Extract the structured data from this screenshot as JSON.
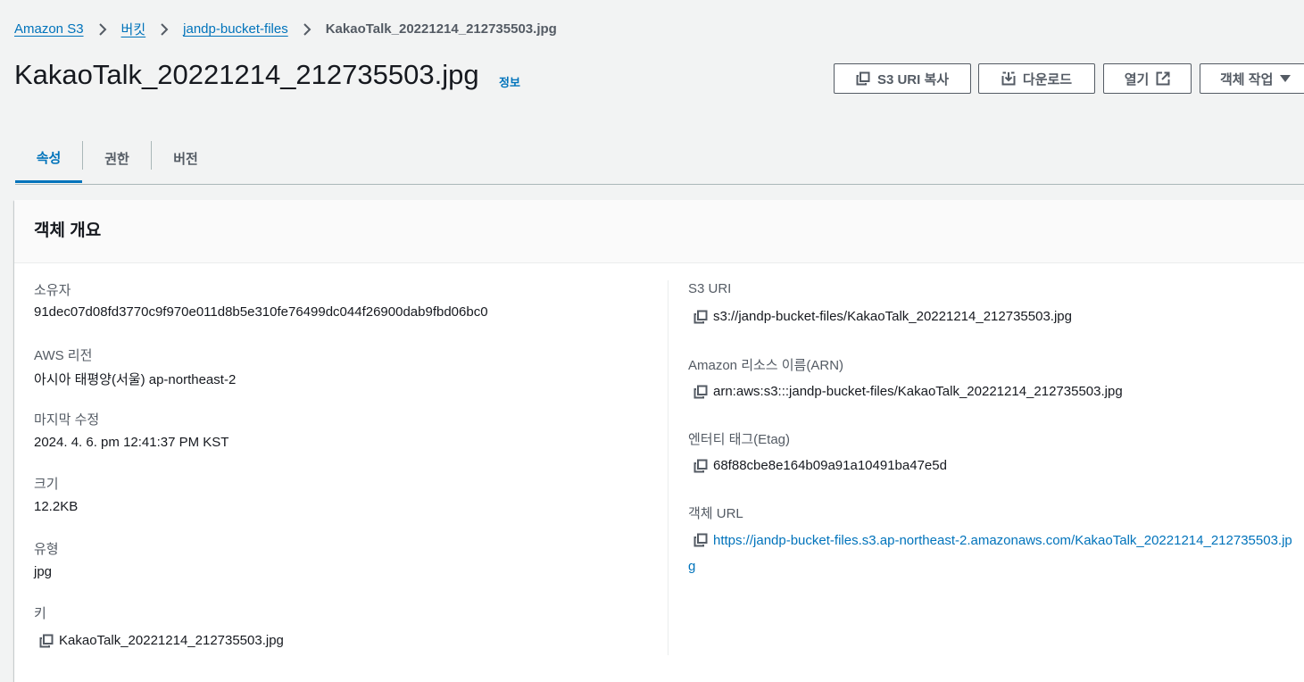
{
  "breadcrumb": {
    "items": [
      "Amazon S3",
      "버킷",
      "jandp-bucket-files"
    ],
    "current": "KakaoTalk_20221214_212735503.jpg"
  },
  "page": {
    "title": "KakaoTalk_20221214_212735503.jpg",
    "info_label": "정보"
  },
  "actions": {
    "copy_uri": "S3 URI 복사",
    "download": "다운로드",
    "open": "열기",
    "object_actions": "객체 작업"
  },
  "tabs": [
    "속성",
    "권한",
    "버전"
  ],
  "panel": {
    "title": "객체 개요",
    "left": {
      "owner_label": "소유자",
      "owner_value": "91dec07d08fd3770c9f970e011d8b5e310fe76499dc044f26900dab9fbd06bc0",
      "region_label": "AWS 리전",
      "region_value": "아시아 태평양(서울) ap-northeast-2",
      "modified_label": "마지막 수정",
      "modified_value": "2024. 4. 6. pm 12:41:37 PM KST",
      "size_label": "크기",
      "size_value": "12.2KB",
      "type_label": "유형",
      "type_value": "jpg",
      "key_label": "키",
      "key_value": "KakaoTalk_20221214_212735503.jpg"
    },
    "right": {
      "s3uri_label": "S3 URI",
      "s3uri_value": "s3://jandp-bucket-files/KakaoTalk_20221214_212735503.jpg",
      "arn_label": "Amazon 리소스 이름(ARN)",
      "arn_value": "arn:aws:s3:::jandp-bucket-files/KakaoTalk_20221214_212735503.jpg",
      "etag_label": "엔터티 태그(Etag)",
      "etag_value": "68f88cbe8e164b09a91a10491ba47e5d",
      "url_label": "객체 URL",
      "url_value": "https://jandp-bucket-files.s3.ap-northeast-2.amazonaws.com/KakaoTalk_20221214_212735503.jpg"
    }
  },
  "colors": {
    "link": "#0073bb",
    "background": "#f2f3f3",
    "text": "#16191f",
    "secondary_text": "#545b64"
  },
  "icons": [
    "chevron-right-icon",
    "copy-icon",
    "download-icon",
    "external-link-icon",
    "caret-down-icon"
  ]
}
